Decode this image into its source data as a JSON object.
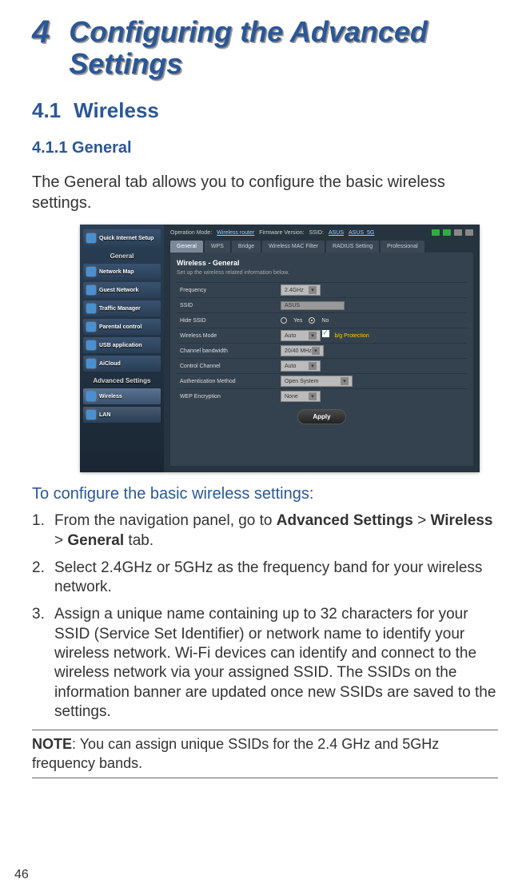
{
  "chapter": {
    "number": "4",
    "title": "Configuring the Advanced Settings"
  },
  "section": {
    "number": "4.1",
    "title": "Wireless"
  },
  "subsection": {
    "number": "4.1.1",
    "title": "General"
  },
  "intro": "The General tab allows you to configure the basic wireless settings.",
  "router": {
    "sidebar": {
      "quickSetup": "Quick Internet Setup",
      "generalHeader": "General",
      "networkMap": "Network Map",
      "guestNetwork": "Guest Network",
      "trafficManager": "Traffic Manager",
      "parentalControl": "Parental control",
      "usbApplication": "USB application",
      "aicloud": "AiCloud",
      "advancedHeader": "Advanced Settings",
      "wireless": "Wireless",
      "lan": "LAN"
    },
    "topbar": {
      "opModeLabel": "Operation Mode:",
      "opMode": "Wireless router",
      "fwLabel": "Firmware Version:",
      "ssidLabel": "SSID:",
      "ssid1": "ASUS",
      "ssid2": "ASUS_5G"
    },
    "tabs": {
      "general": "General",
      "wps": "WPS",
      "bridge": "Bridge",
      "macfilter": "Wireless MAC Filter",
      "radius": "RADIUS Setting",
      "professional": "Professional"
    },
    "panel": {
      "title": "Wireless - General",
      "desc": "Set up the wireless related information below."
    },
    "form": {
      "frequency": {
        "label": "Frequency",
        "value": "2.4GHz"
      },
      "ssid": {
        "label": "SSID",
        "value": "ASUS"
      },
      "hideSsid": {
        "label": "Hide SSID",
        "yes": "Yes",
        "no": "No"
      },
      "wirelessMode": {
        "label": "Wireless Mode",
        "value": "Auto",
        "bgProtect": "b/g Protection"
      },
      "channelBw": {
        "label": "Channel bandwidth",
        "value": "20/40 MHz"
      },
      "controlChannel": {
        "label": "Control Channel",
        "value": "Auto"
      },
      "authMethod": {
        "label": "Authentication Method",
        "value": "Open System"
      },
      "wep": {
        "label": "WEP Encryption",
        "value": "None"
      },
      "apply": "Apply"
    }
  },
  "instructionsHeading": "To configure the basic wireless settings:",
  "steps": {
    "s1a": "From the navigation panel, go to ",
    "s1b": "Advanced Settings",
    "s1c": " > ",
    "s1d": "Wireless",
    "s1e": " > ",
    "s1f": "General",
    "s1g": " tab.",
    "s2": "Select 2.4GHz or 5GHz as the frequency band for your wireless network.",
    "s3": "Assign a unique name containing up to 32 characters for your SSID (Service Set Identifier) or network name to identify your wireless network. Wi-Fi devices can identify and connect to the wireless network via your assigned SSID. The SSIDs on the information banner are updated once new SSIDs are saved to the settings."
  },
  "note": {
    "label": "NOTE",
    "sep": ":   ",
    "text": "You can assign unique SSIDs for the 2.4 GHz and 5GHz frequency bands."
  },
  "pageNumber": "46"
}
